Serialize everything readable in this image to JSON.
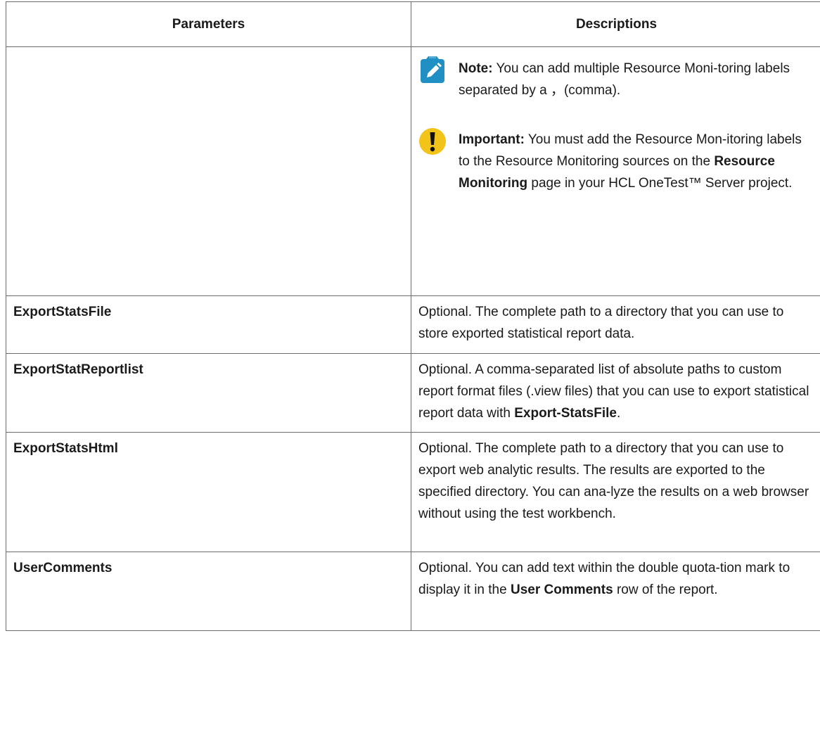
{
  "table": {
    "headers": {
      "parameters": "Parameters",
      "descriptions": "Descriptions"
    },
    "rows": [
      {
        "param": "",
        "callouts": [
          {
            "type": "note",
            "icon": "pencil-note-icon",
            "label": "Note:",
            "text": " You can add multiple Resource Moni-toring labels separated by a ，(comma)."
          },
          {
            "type": "important",
            "icon": "exclamation-important-icon",
            "label": "Important:",
            "text_before": " You must add the Resource Mon-itoring labels to the Resource Monitoring sources on the ",
            "bold": "Resource Monitoring",
            "text_after": " page in your HCL OneTest™ Server project."
          }
        ]
      },
      {
        "param": "ExportStatsFile",
        "desc": "Optional. The complete path to a directory that you can use to store exported statistical report data."
      },
      {
        "param": "ExportStatReportlist",
        "desc_before": "Optional. A comma-separated list of absolute paths to custom report format files (.view files) that you can use to export statistical report data with ",
        "desc_bold": "Export-StatsFile",
        "desc_after": "."
      },
      {
        "param": "ExportStatsHtml",
        "desc": "Optional. The complete path to a directory that you can use to export web analytic results. The results are exported to the specified directory. You can ana-lyze the results on a web browser without using the test workbench."
      },
      {
        "param": "UserComments",
        "desc_before": "Optional. You can add text within the double quota-tion mark to display it in the ",
        "desc_bold": "User Comments",
        "desc_after": " row of the report."
      }
    ]
  },
  "colors": {
    "note_icon_bg": "#1f8fc4",
    "important_icon_bg": "#f2c318",
    "border": "#6b6b6b",
    "text": "#1a1a1a"
  }
}
